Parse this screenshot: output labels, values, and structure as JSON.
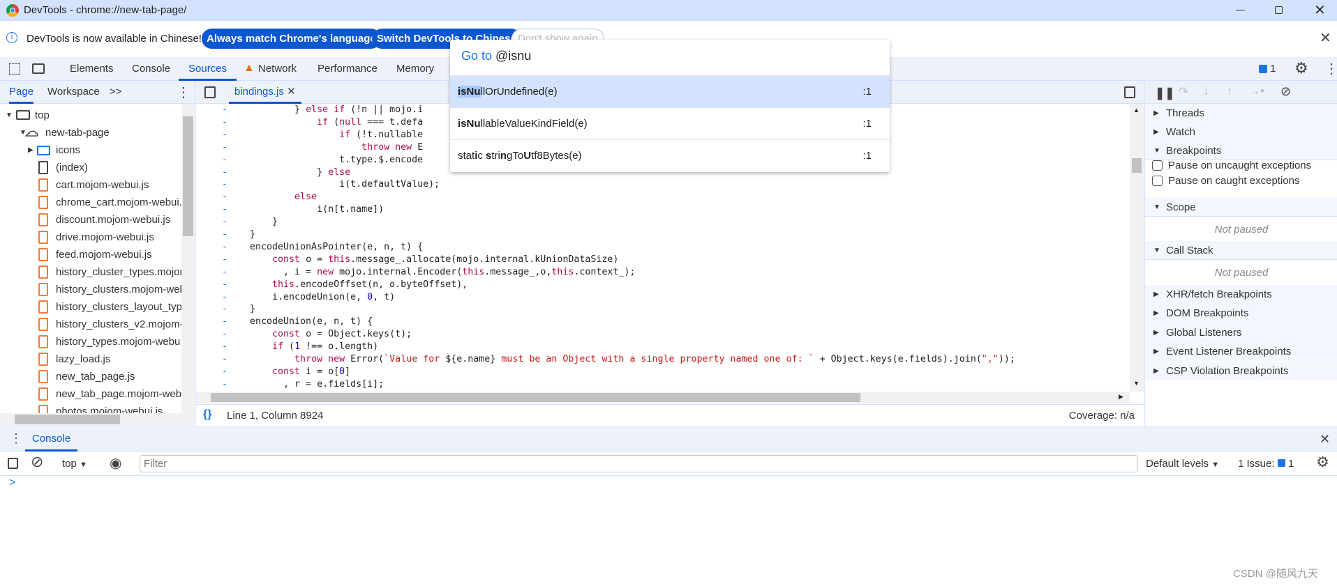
{
  "window": {
    "title": "DevTools - chrome://new-tab-page/"
  },
  "infobar": {
    "message": "DevTools is now available in Chinese!",
    "btn_match": "Always match Chrome's language",
    "btn_switch": "Switch DevTools to Chinese",
    "btn_dont_show": "Don't show again"
  },
  "tabs": [
    {
      "label": "Elements"
    },
    {
      "label": "Console"
    },
    {
      "label": "Sources",
      "selected": true
    },
    {
      "label": "Network",
      "warning": true
    },
    {
      "label": "Performance"
    },
    {
      "label": "Memory"
    }
  ],
  "toolbar_right": {
    "issues_count": "1"
  },
  "navigator": {
    "tabs": [
      "Page",
      "Workspace"
    ],
    "more": ">>",
    "tree": [
      {
        "label": "top",
        "depth": 0,
        "icon": "frame-icon",
        "expanded": true
      },
      {
        "label": "new-tab-page",
        "depth": 1,
        "icon": "cloud-icon",
        "expanded": true
      },
      {
        "label": "icons",
        "depth": 2,
        "icon": "folder-icon",
        "expanded": false
      },
      {
        "label": "(index)",
        "depth": 2,
        "icon": "document-icon"
      },
      {
        "label": "cart.mojom-webui.js",
        "depth": 2,
        "icon": "script-file-icon"
      },
      {
        "label": "chrome_cart.mojom-webui.",
        "depth": 2,
        "icon": "script-file-icon"
      },
      {
        "label": "discount.mojom-webui.js",
        "depth": 2,
        "icon": "script-file-icon"
      },
      {
        "label": "drive.mojom-webui.js",
        "depth": 2,
        "icon": "script-file-icon"
      },
      {
        "label": "feed.mojom-webui.js",
        "depth": 2,
        "icon": "script-file-icon"
      },
      {
        "label": "history_cluster_types.mojom",
        "depth": 2,
        "icon": "script-file-icon"
      },
      {
        "label": "history_clusters.mojom-web",
        "depth": 2,
        "icon": "script-file-icon"
      },
      {
        "label": "history_clusters_layout_type",
        "depth": 2,
        "icon": "script-file-icon"
      },
      {
        "label": "history_clusters_v2.mojom-",
        "depth": 2,
        "icon": "script-file-icon"
      },
      {
        "label": "history_types.mojom-webu",
        "depth": 2,
        "icon": "script-file-icon"
      },
      {
        "label": "lazy_load.js",
        "depth": 2,
        "icon": "script-file-icon"
      },
      {
        "label": "new_tab_page.js",
        "depth": 2,
        "icon": "script-file-icon"
      },
      {
        "label": "new_tab_page.mojom-web",
        "depth": 2,
        "icon": "script-file-icon"
      },
      {
        "label": "photos.mojom-webui.js",
        "depth": 2,
        "icon": "script-file-icon"
      }
    ]
  },
  "editor": {
    "open_file": "bindings.js",
    "lines": [
      "        } else if (!n || mojo.i",
      "            if (null === t.defa",
      "                if (!t.nullable",
      "                    throw new E",
      "                t.type.$.encode",
      "            } else",
      "                i(t.defaultValue);",
      "        else",
      "            i(n[t.name])",
      "    }",
      "}",
      "encodeUnionAsPointer(e, n, t) {",
      "    const o = this.message_.allocate(mojo.internal.kUnionDataSize)",
      "      , i = new mojo.internal.Encoder(this.message_,o,this.context_);",
      "    this.encodeOffset(n, o.byteOffset),",
      "    i.encodeUnion(e, 0, t)",
      "}",
      "encodeUnion(e, n, t) {",
      "    const o = Object.keys(t);",
      "    if (1 !== o.length)",
      "        throw new Error(`Value for ${e.name} must be an Object with a single property named one of: ` + Object.keys(e.fields).join(\",\"));",
      "    const i = o[0]",
      "      , r = e.fields[i];"
    ],
    "gutter_mark": "-",
    "status_position": "Line 1, Column 8924",
    "coverage": "Coverage: n/a"
  },
  "goto": {
    "prefix": "Go to ",
    "query": "@isnu",
    "items": [
      {
        "segments": [
          {
            "t": "isNu",
            "b": true,
            "hl": true
          },
          {
            "t": "llOrUndefined(e)"
          }
        ],
        "line": ":1",
        "selected": true
      },
      {
        "segments": [
          {
            "t": "isNu",
            "b": true
          },
          {
            "t": "llableValueKindField(e)"
          }
        ],
        "line": ":1"
      },
      {
        "segments": [
          {
            "t": "stat"
          },
          {
            "t": "i",
            "b": true
          },
          {
            "t": "c "
          },
          {
            "t": "s",
            "b": true
          },
          {
            "t": "tri"
          },
          {
            "t": "n",
            "b": true
          },
          {
            "t": "gTo"
          },
          {
            "t": "U",
            "b": true
          },
          {
            "t": "tf8Bytes(e)"
          }
        ],
        "line": ":1"
      }
    ]
  },
  "debugger": {
    "sections": [
      {
        "label": "Threads",
        "expanded": false
      },
      {
        "label": "Watch",
        "expanded": false
      },
      {
        "label": "Breakpoints",
        "expanded": true
      },
      {
        "label": "Scope",
        "expanded": true
      },
      {
        "label": "Call Stack",
        "expanded": true
      },
      {
        "label": "XHR/fetch Breakpoints",
        "expanded": false
      },
      {
        "label": "DOM Breakpoints",
        "expanded": false
      },
      {
        "label": "Global Listeners",
        "expanded": false
      },
      {
        "label": "Event Listener Breakpoints",
        "expanded": false
      },
      {
        "label": "CSP Violation Breakpoints",
        "expanded": false
      }
    ],
    "checkboxes": [
      {
        "label": "Pause on uncaught exceptions",
        "checked": false
      },
      {
        "label": "Pause on caught exceptions",
        "checked": false
      }
    ],
    "not_paused": "Not paused"
  },
  "drawer": {
    "tab": "Console",
    "context": "top",
    "filter_placeholder": "Filter",
    "levels": "Default levels",
    "issues_label": "1 Issue:",
    "issues_count": "1",
    "prompt": ">"
  },
  "watermark": "CSDN @随风九天",
  "colors": {
    "accent": "#0b57d0",
    "titlebar": "#d3e3fd",
    "toolbar": "#edf1fa",
    "selection": "#d3e3fd",
    "file_icon": "#f07b3f",
    "warning": "#e8710a"
  }
}
